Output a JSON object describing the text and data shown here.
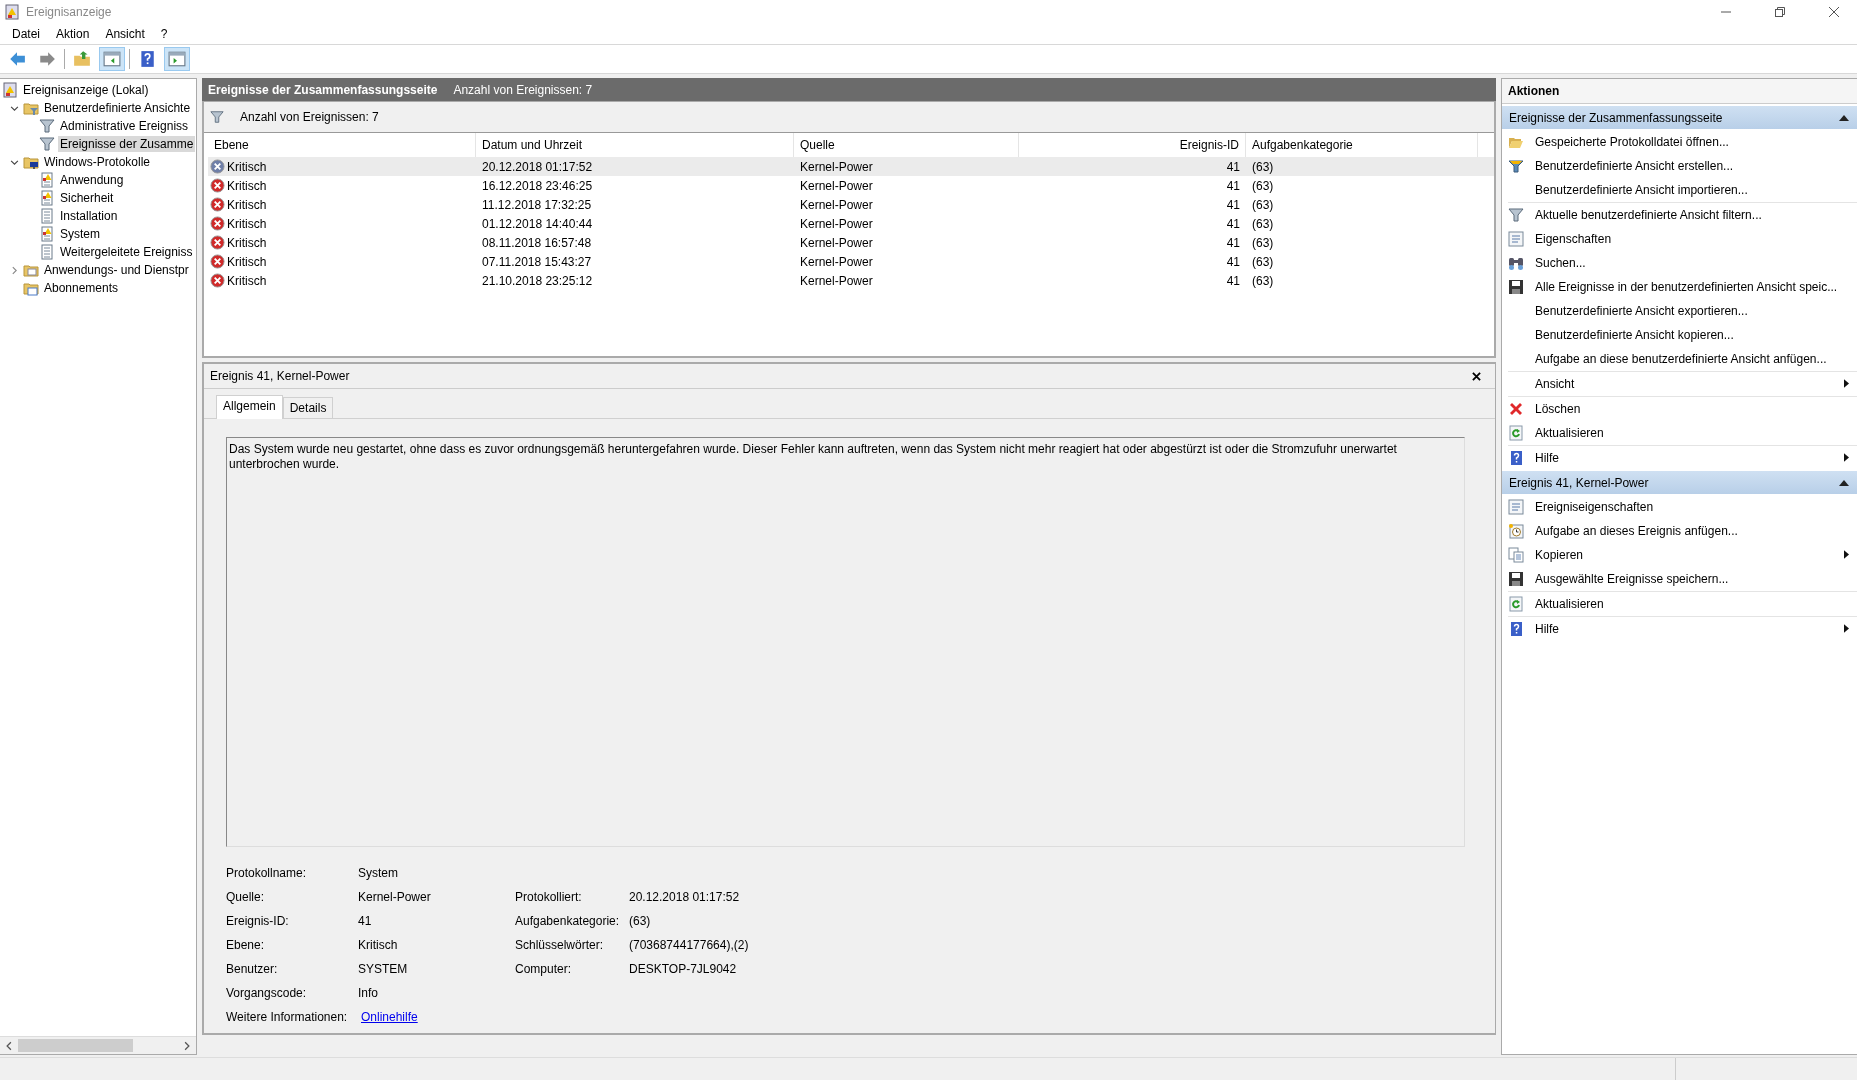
{
  "window": {
    "title": "Ereignisanzeige"
  },
  "menu": [
    "Datei",
    "Aktion",
    "Ansicht",
    "?"
  ],
  "toolbar": [
    {
      "kind": "back",
      "on": false
    },
    {
      "kind": "forward",
      "on": false
    },
    {
      "kind": "up",
      "on": false
    },
    {
      "kind": "tree",
      "on": true
    },
    {
      "kind": "help",
      "on": false
    },
    {
      "kind": "pane",
      "on": true
    }
  ],
  "tree": [
    {
      "label": "Ereignisanzeige (Lokal)",
      "kind": "viewer",
      "selected": false,
      "children": [
        {
          "label": "Benutzerdefinierte Ansichte",
          "kind": "folder-filter",
          "expanded": true,
          "selected": false,
          "children": [
            {
              "label": "Administrative Ereigniss",
              "kind": "filter",
              "selected": false
            },
            {
              "label": "Ereignisse der Zusamme",
              "kind": "filter",
              "selected": true
            }
          ]
        },
        {
          "label": "Windows-Protokolle",
          "kind": "folder-pc",
          "expanded": true,
          "selected": false,
          "children": [
            {
              "label": "Anwendung",
              "kind": "log-warn",
              "selected": false
            },
            {
              "label": "Sicherheit",
              "kind": "log-warn",
              "selected": false
            },
            {
              "label": "Installation",
              "kind": "log",
              "selected": false
            },
            {
              "label": "System",
              "kind": "log-warn",
              "selected": false
            },
            {
              "label": "Weitergeleitete Ereigniss",
              "kind": "log",
              "selected": false
            }
          ]
        },
        {
          "label": "Anwendungs- und Dienstpr",
          "kind": "folder",
          "expanded": false,
          "selected": false
        },
        {
          "label": "Abonnements",
          "kind": "folder-sub",
          "selected": false
        }
      ]
    }
  ],
  "view": {
    "title": "Ereignisse der Zusammenfassungsseite",
    "count": "Anzahl von Ereignissen: 7"
  },
  "filter_bar": {
    "text": "Anzahl von Ereignissen: 7"
  },
  "table": {
    "columns": [
      {
        "label": "Ebene",
        "kind": "text"
      },
      {
        "label": "Datum und Uhrzeit",
        "kind": "text"
      },
      {
        "label": "Quelle",
        "kind": "text"
      },
      {
        "label": "Ereignis-ID",
        "kind": "number"
      },
      {
        "label": "Aufgabenkategorie",
        "kind": "text"
      }
    ],
    "rows": [
      {
        "level": "Kritisch",
        "date": "20.12.2018 01:17:52",
        "source": "Kernel-Power",
        "id": "41",
        "category": "(63)",
        "selected": true
      },
      {
        "level": "Kritisch",
        "date": "16.12.2018 23:46:25",
        "source": "Kernel-Power",
        "id": "41",
        "category": "(63)",
        "selected": false
      },
      {
        "level": "Kritisch",
        "date": "11.12.2018 17:32:25",
        "source": "Kernel-Power",
        "id": "41",
        "category": "(63)",
        "selected": false
      },
      {
        "level": "Kritisch",
        "date": "01.12.2018 14:40:44",
        "source": "Kernel-Power",
        "id": "41",
        "category": "(63)",
        "selected": false
      },
      {
        "level": "Kritisch",
        "date": "08.11.2018 16:57:48",
        "source": "Kernel-Power",
        "id": "41",
        "category": "(63)",
        "selected": false
      },
      {
        "level": "Kritisch",
        "date": "07.11.2018 15:43:27",
        "source": "Kernel-Power",
        "id": "41",
        "category": "(63)",
        "selected": false
      },
      {
        "level": "Kritisch",
        "date": "21.10.2018 23:25:12",
        "source": "Kernel-Power",
        "id": "41",
        "category": "(63)",
        "selected": false
      }
    ]
  },
  "details": {
    "title": "Ereignis 41, Kernel-Power",
    "tabs": [
      {
        "label": "Allgemein",
        "selected": true
      },
      {
        "label": "Details",
        "selected": false
      }
    ],
    "description": "Das System wurde neu gestartet, ohne dass es zuvor ordnungsgemäß heruntergefahren wurde. Dieser Fehler kann auftreten, wenn das System nicht mehr reagiert hat oder abgestürzt ist oder die Stromzufuhr unerwartet unterbrochen wurde.",
    "fields": [
      [
        {
          "label": "Protokollname:",
          "value": "System"
        }
      ],
      [
        {
          "label": "Quelle:",
          "value": "Kernel-Power"
        },
        {
          "label": "Protokolliert:",
          "value": "20.12.2018 01:17:52"
        }
      ],
      [
        {
          "label": "Ereignis-ID:",
          "value": "41"
        },
        {
          "label": "Aufgabenkategorie:",
          "value": "(63)"
        }
      ],
      [
        {
          "label": "Ebene:",
          "value": "Kritisch"
        },
        {
          "label": "Schlüsselwörter:",
          "value": "(70368744177664),(2)"
        }
      ],
      [
        {
          "label": "Benutzer:",
          "value": "SYSTEM"
        },
        {
          "label": "Computer:",
          "value": "DESKTOP-7JL9042"
        }
      ],
      [
        {
          "label": "Vorgangscode:",
          "value": "Info"
        }
      ],
      [
        {
          "label": "Weitere Informationen:",
          "value": "Onlinehilfe",
          "kind": "link"
        }
      ]
    ]
  },
  "actions": {
    "title": "Aktionen",
    "sections": [
      {
        "title": "Ereignisse der Zusammenfassungsseite",
        "expanded": true,
        "items": [
          {
            "label": "Gespeicherte Protokolldatei öffnen...",
            "kind": "folder-open",
            "submenu": false,
            "divider": false
          },
          {
            "label": "Benutzerdefinierte Ansicht erstellen...",
            "kind": "filter-new",
            "submenu": false,
            "divider": false
          },
          {
            "label": "Benutzerdefinierte Ansicht importieren...",
            "kind": "none",
            "submenu": false,
            "divider": false
          },
          {
            "label": "Aktuelle benutzerdefinierte Ansicht filtern...",
            "kind": "filter",
            "submenu": false,
            "divider": true
          },
          {
            "label": "Eigenschaften",
            "kind": "properties",
            "submenu": false,
            "divider": false
          },
          {
            "label": "Suchen...",
            "kind": "binoculars",
            "submenu": false,
            "divider": false
          },
          {
            "label": "Alle Ereignisse in der benutzerdefinierten Ansicht speic...",
            "kind": "save",
            "submenu": false,
            "divider": false
          },
          {
            "label": "Benutzerdefinierte Ansicht exportieren...",
            "kind": "none",
            "submenu": false,
            "divider": false
          },
          {
            "label": "Benutzerdefinierte Ansicht kopieren...",
            "kind": "none",
            "submenu": false,
            "divider": false
          },
          {
            "label": "Aufgabe an diese benutzerdefinierte Ansicht anfügen...",
            "kind": "none",
            "submenu": false,
            "divider": false
          },
          {
            "label": "Ansicht",
            "kind": "none",
            "submenu": true,
            "divider": true
          },
          {
            "label": "Löschen",
            "kind": "delete",
            "submenu": false,
            "divider": true
          },
          {
            "label": "Aktualisieren",
            "kind": "refresh",
            "submenu": false,
            "divider": false
          },
          {
            "label": "Hilfe",
            "kind": "help",
            "submenu": true,
            "divider": true
          }
        ]
      },
      {
        "title": "Ereignis 41, Kernel-Power",
        "expanded": true,
        "items": [
          {
            "label": "Ereigniseigenschaften",
            "kind": "properties",
            "submenu": false,
            "divider": false
          },
          {
            "label": "Aufgabe an dieses Ereignis anfügen...",
            "kind": "task",
            "submenu": false,
            "divider": false
          },
          {
            "label": "Kopieren",
            "kind": "copy",
            "submenu": true,
            "divider": false
          },
          {
            "label": "Ausgewählte Ereignisse speichern...",
            "kind": "save",
            "submenu": false,
            "divider": false
          },
          {
            "label": "Aktualisieren",
            "kind": "refresh",
            "submenu": false,
            "divider": true
          },
          {
            "label": "Hilfe",
            "kind": "help",
            "submenu": true,
            "divider": true
          }
        ]
      }
    ]
  }
}
